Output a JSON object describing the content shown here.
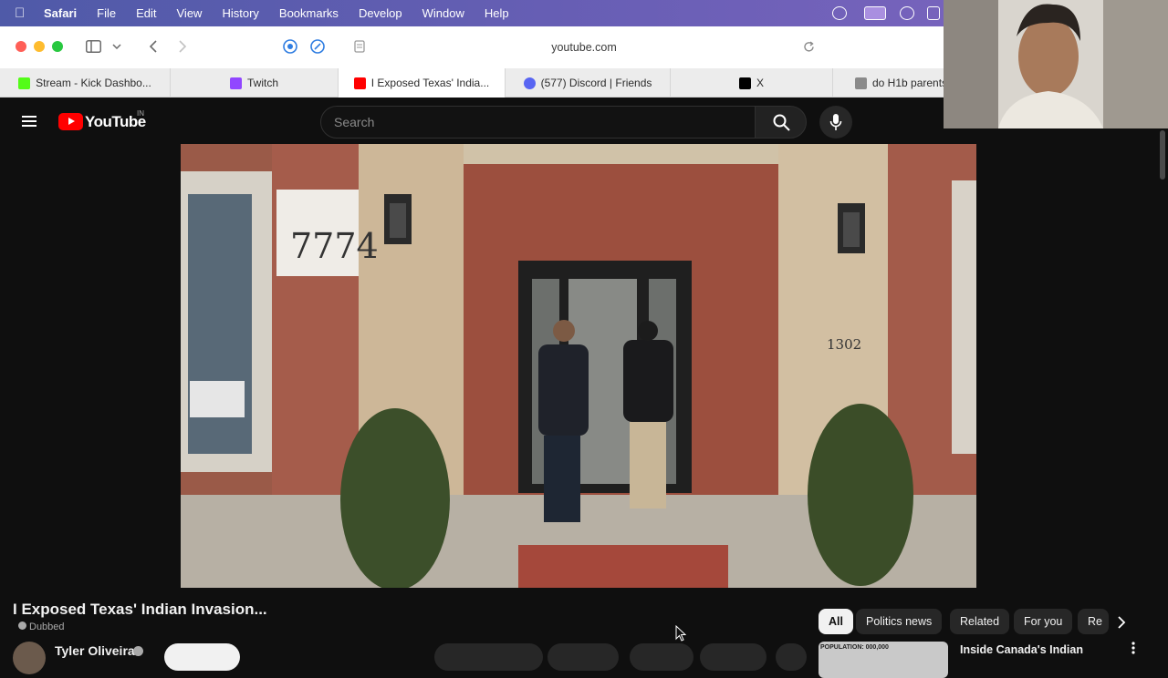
{
  "menubar": {
    "app": "Safari",
    "items": [
      "File",
      "Edit",
      "View",
      "History",
      "Bookmarks",
      "Develop",
      "Window",
      "Help"
    ]
  },
  "toolbar": {
    "url": "youtube.com"
  },
  "tabs": [
    {
      "label": "Stream - Kick Dashbo...",
      "favicon_color": "#53fc18"
    },
    {
      "label": "Twitch",
      "favicon_color": "#9146ff"
    },
    {
      "label": "I Exposed Texas' India...",
      "favicon_color": "#ff0000",
      "active": true
    },
    {
      "label": "(577) Discord | Friends",
      "favicon_color": "#5865f2"
    },
    {
      "label": "X",
      "favicon_color": "#000000"
    },
    {
      "label": "do H1b parents",
      "favicon_color": "#8a8a8a"
    }
  ],
  "youtube": {
    "logo_text": "YouTube",
    "country_code": "IN",
    "search_placeholder": "Search"
  },
  "video": {
    "house_number_left": "7774",
    "house_number_right": "1302"
  },
  "below": {
    "title": "I Exposed Texas' Indian Invasion...",
    "dubbed": "Dubbed",
    "channel": "Tyler Oliveira"
  },
  "chips": [
    "All",
    "Politics news",
    "Related",
    "For you",
    "Re"
  ],
  "recommended": {
    "thumb_text": "POPULATION: 000,000",
    "title": "Inside Canada's Indian"
  },
  "colors": {
    "youtube_red": "#ff0000",
    "bg": "#0f0f0f",
    "menubar": "#5f5caf"
  }
}
